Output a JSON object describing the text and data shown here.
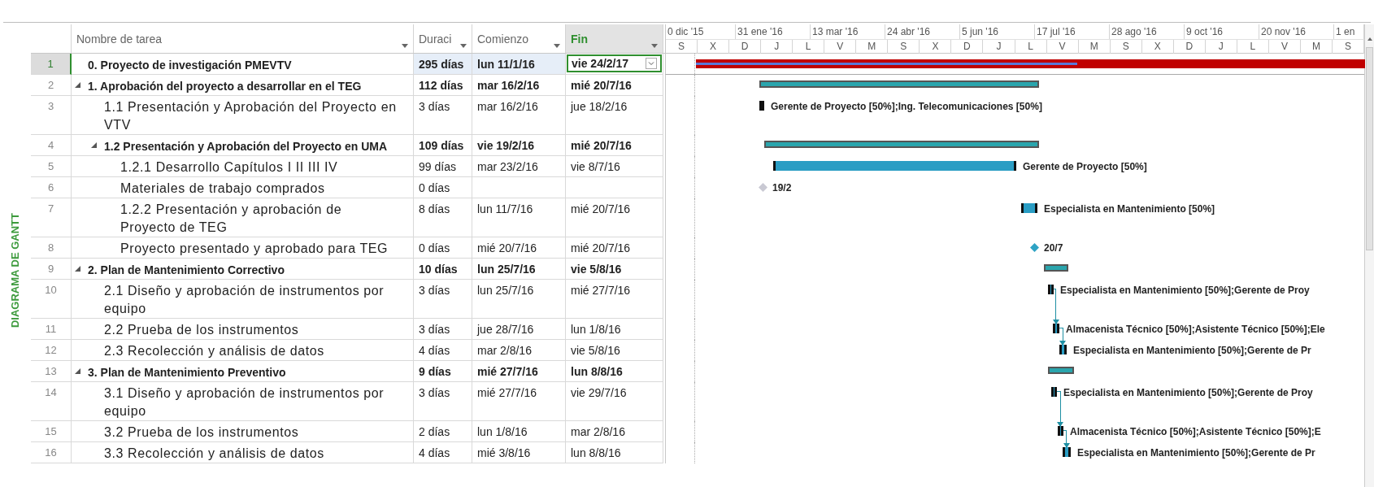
{
  "side_label": "DIAGRAMA DE GANTT",
  "columns": [
    {
      "label": "Nombre de tarea",
      "selected": false
    },
    {
      "label": "Duraci",
      "selected": false
    },
    {
      "label": "Comienzo",
      "selected": false
    },
    {
      "label": "Fin",
      "selected": true
    }
  ],
  "timescale": {
    "top": [
      "0 dic '15",
      "31 ene '16",
      "13 mar '16",
      "24 abr '16",
      "5 jun '16",
      "17 jul '16",
      "28 ago '16",
      "9 oct '16",
      "20 nov '16",
      "1 en"
    ],
    "bottom": [
      "S",
      "X",
      "D",
      "J",
      "L",
      "V",
      "M",
      "S",
      "X",
      "D",
      "J",
      "L",
      "V",
      "M",
      "S",
      "X",
      "D",
      "J",
      "L",
      "V",
      "M",
      "S"
    ]
  },
  "tasks": [
    {
      "num": "1",
      "name": "0. Proyecto de investigación PMEVTV",
      "duration": "295 días",
      "start": "lun 11/1/16",
      "end": "vie 24/2/17",
      "selected": true,
      "bar": {
        "kind": "project",
        "level": 0.57,
        "linked": false
      }
    },
    {
      "num": "2",
      "name": "1. Aprobación del proyecto a desarrollar en el TEG",
      "duration": "112 días",
      "start": "mar 16/2/16",
      "end": "mié 20/7/16",
      "selected": false,
      "expanded": true,
      "bar": {
        "kind": "summary",
        "linked": false
      },
      "children": [
        {
          "num": "3",
          "name": "1.1 Presentación y Aprobación del Proyecto en VTV",
          "duration": "3 días",
          "start": "mar 16/2/16",
          "end": "jue 18/2/16",
          "selected": false,
          "bar": {
            "kind": "task",
            "label": "Gerente de Proyecto  [50%];Ing. Telecomunicaciones  [50%]",
            "linked": false
          }
        },
        {
          "num": "4",
          "name": "1.2 Presentación y Aprobación del Proyecto en UMA",
          "duration": "109 días",
          "start": "vie 19/2/16",
          "end": "mié 20/7/16",
          "selected": false,
          "expanded": true,
          "bar": {
            "kind": "summary",
            "linked": false
          },
          "children": [
            {
              "num": "5",
              "name": "1.2.1 Desarrollo Capítulos I II III IV",
              "duration": "99 días",
              "start": "mar 23/2/16",
              "end": "vie 8/7/16",
              "selected": false,
              "bar": {
                "kind": "task",
                "label": "Gerente de Proyecto  [50%]",
                "linked": false
              }
            },
            {
              "num": "6",
              "name": "Materiales de trabajo comprados",
              "duration": "0 días",
              "selected": false,
              "bar": {
                "kind": "milestone",
                "inactive": true,
                "label": "19/2",
                "linked": false
              }
            },
            {
              "num": "7",
              "name": "1.2.2 Presentación y aprobación de Proyecto de TEG",
              "duration": "8 días",
              "start": "lun 11/7/16",
              "end": "mié 20/7/16",
              "selected": false,
              "bar": {
                "kind": "task",
                "label": "Especialista en Mantenimiento [50%]",
                "linked": false
              }
            },
            {
              "num": "8",
              "name": "Proyecto presentado y aprobado para TEG",
              "duration": "0 días",
              "start": "mié 20/7/16",
              "end": "mié 20/7/16",
              "selected": false,
              "bar": {
                "kind": "milestone",
                "inactive": false,
                "label": "20/7",
                "linked": false
              }
            }
          ]
        }
      ]
    },
    {
      "num": "9",
      "name": "2. Plan de Mantenimiento Correctivo",
      "duration": "10 días",
      "start": "lun 25/7/16",
      "end": "vie 5/8/16",
      "selected": false,
      "expanded": true,
      "bar": {
        "kind": "summary",
        "linked": false
      },
      "children": [
        {
          "num": "10",
          "name": "2.1 Diseño y aprobación de instrumentos por equipo",
          "duration": "3 días",
          "start": "lun 25/7/16",
          "end": "mié 27/7/16",
          "selected": false,
          "bar": {
            "kind": "task",
            "label": "Especialista en Mantenimiento [50%];Gerente de Proy",
            "linked": true
          }
        },
        {
          "num": "11",
          "name": "2.2 Prueba de los instrumentos",
          "duration": "3 días",
          "start": "jue 28/7/16",
          "end": "lun 1/8/16",
          "selected": false,
          "bar": {
            "kind": "task",
            "label": "Almacenista Técnico [50%];Asistente Técnico [50%];Ele",
            "linked": true
          }
        },
        {
          "num": "12",
          "name": "2.3 Recolección y análisis de datos",
          "duration": "4 días",
          "start": "mar 2/8/16",
          "end": "vie 5/8/16",
          "selected": false,
          "bar": {
            "kind": "task",
            "label": "Especialista en Mantenimiento [50%];Gerente de Pr",
            "linked": false
          }
        }
      ]
    },
    {
      "num": "13",
      "name": "3. Plan de Mantenimiento Preventivo",
      "duration": "9 días",
      "start": "mié 27/7/16",
      "end": "lun 8/8/16",
      "selected": false,
      "expanded": true,
      "bar": {
        "kind": "summary",
        "linked": false
      },
      "children": [
        {
          "num": "14",
          "name": "3.1 Diseño y aprobación de instrumentos por equipo",
          "duration": "3 días",
          "start": "mié 27/7/16",
          "end": "vie 29/7/16",
          "selected": false,
          "bar": {
            "kind": "task",
            "label": "Especialista en Mantenimiento [50%];Gerente de Proy",
            "linked": true
          }
        },
        {
          "num": "15",
          "name": "3.2 Prueba de los instrumentos",
          "duration": "2 días",
          "start": "lun 1/8/16",
          "end": "mar 2/8/16",
          "selected": false,
          "bar": {
            "kind": "task",
            "label": "Almacenista Técnico [50%];Asistente Técnico [50%];E",
            "linked": true
          }
        },
        {
          "num": "16",
          "name": "3.3 Recolección y análisis de datos",
          "duration": "4 días",
          "start": "mié 3/8/16",
          "end": "lun 8/8/16",
          "selected": false,
          "bar": {
            "kind": "task",
            "label": "Especialista en Mantenimiento [50%];Gerente de Pr",
            "linked": false
          }
        }
      ]
    }
  ]
}
